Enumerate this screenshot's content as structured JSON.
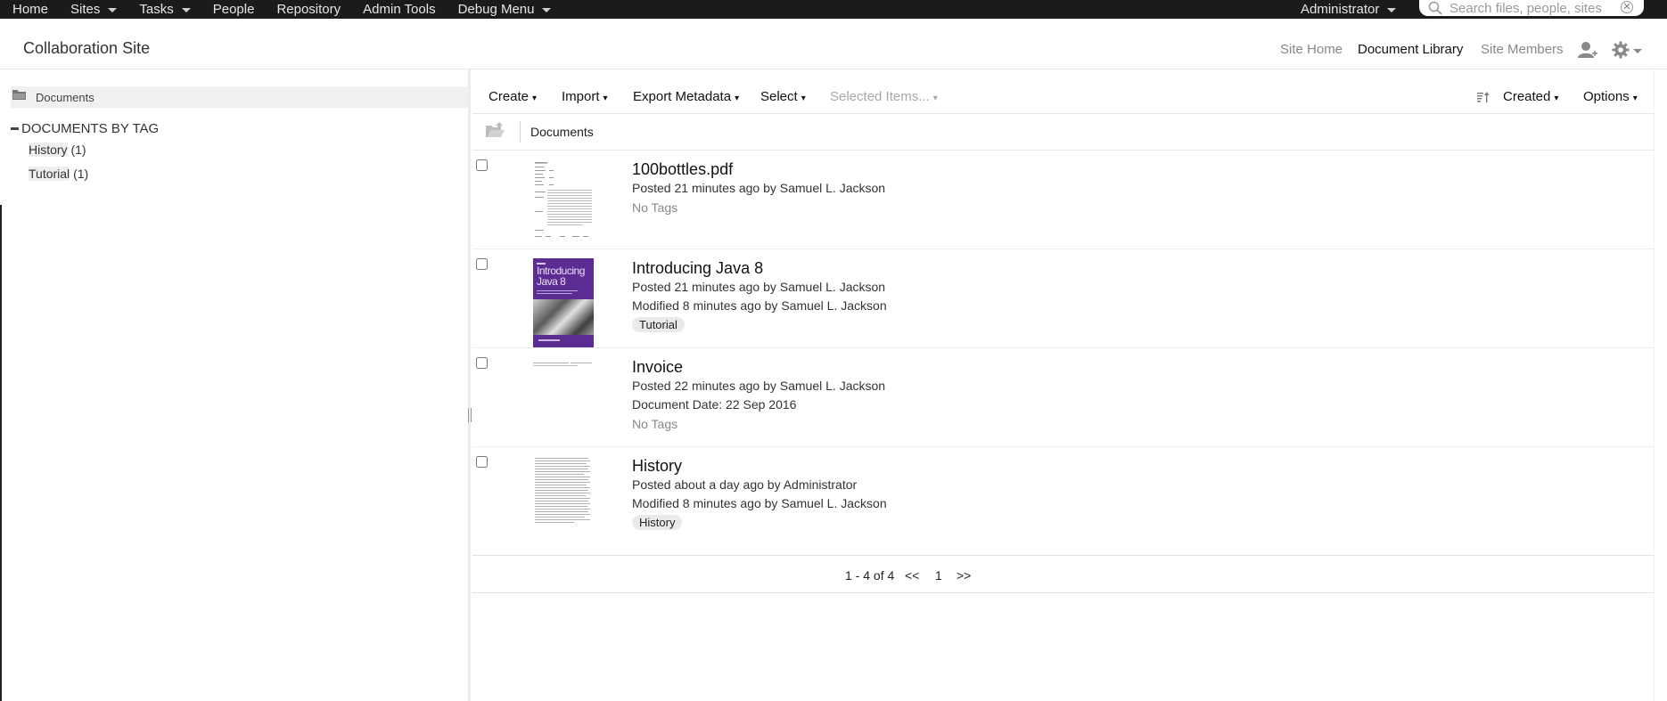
{
  "topbar": {
    "nav": [
      {
        "label": "Home",
        "dropdown": false
      },
      {
        "label": "Sites",
        "dropdown": true
      },
      {
        "label": "Tasks",
        "dropdown": true
      },
      {
        "label": "People",
        "dropdown": false
      },
      {
        "label": "Repository",
        "dropdown": false
      },
      {
        "label": "Admin Tools",
        "dropdown": false
      },
      {
        "label": "Debug Menu",
        "dropdown": true
      }
    ],
    "user": "Administrator",
    "search_placeholder": "Search files, people, sites"
  },
  "site": {
    "title": "Collaboration Site",
    "nav": [
      "Site Home",
      "Document Library",
      "Site Members"
    ],
    "active_nav": "Document Library"
  },
  "sidebar": {
    "documents_label": "Documents",
    "tag_heading": "DOCUMENTS BY TAG",
    "tags": [
      {
        "name": "History",
        "count": "(1)"
      },
      {
        "name": "Tutorial",
        "count": "(1)"
      }
    ]
  },
  "toolbar": {
    "create": "Create",
    "import": "Import",
    "export": "Export Metadata",
    "select": "Select",
    "selected_items": "Selected Items...",
    "sort": "Created",
    "options": "Options",
    "arrow": "▾"
  },
  "path": {
    "crumb": "Documents"
  },
  "documents": [
    {
      "title": "100bottles.pdf",
      "lines": [
        "Posted 21 minutes ago by Samuel L. Jackson"
      ],
      "tag": null,
      "no_tags": "No Tags",
      "thumb": "pdf-page"
    },
    {
      "title": "Introducing Java 8",
      "lines": [
        "Posted 21 minutes ago by Samuel L. Jackson",
        "Modified 8 minutes ago by Samuel L. Jackson"
      ],
      "tag": "Tutorial",
      "no_tags": null,
      "thumb": "book-cover",
      "cover_text": [
        "Introducing",
        "Java 8"
      ]
    },
    {
      "title": "Invoice",
      "lines": [
        "Posted 22 minutes ago by Samuel L. Jackson",
        "Document Date: 22 Sep 2016"
      ],
      "tag": null,
      "no_tags": "No Tags",
      "thumb": "invoice-strip"
    },
    {
      "title": "History",
      "lines": [
        "Posted about a day ago by Administrator",
        "Modified 8 minutes ago by Samuel L. Jackson"
      ],
      "tag": "History",
      "no_tags": null,
      "thumb": "text-page"
    }
  ],
  "pagination": {
    "range": "1 - 4 of 4",
    "prev": "<<",
    "page": "1",
    "next": ">>"
  },
  "colors": {
    "topbar": "#1b1b1b",
    "book_cover": "#5b2c91"
  }
}
